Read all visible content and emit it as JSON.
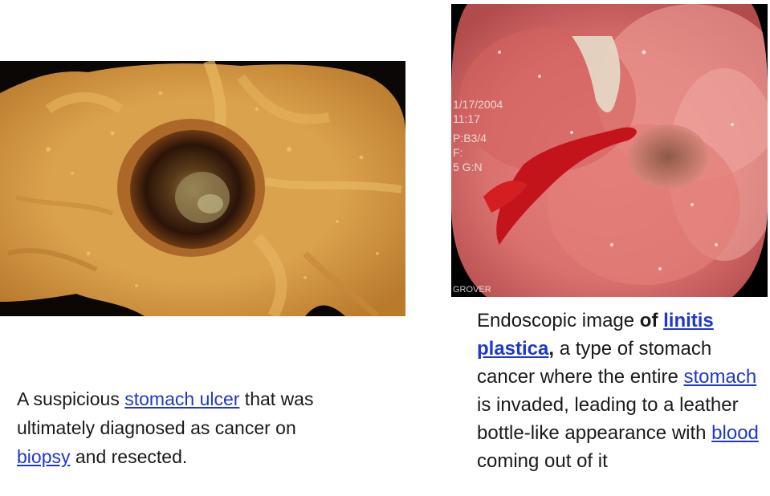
{
  "left_caption": {
    "part1": "A suspicious ",
    "link1": "stomach ulcer",
    "part2": " that was ultimately diagnosed as cancer on ",
    "link2": "biopsy",
    "part3": " and resected."
  },
  "right_caption": {
    "part1": "Endoscopic image ",
    "bold1": "of ",
    "link1": "linitis plastica",
    "bold2": ",",
    "part2": " a type of stomach cancer where the entire ",
    "link2": "stomach",
    "part3": " is invaded, leading to a leather bottle-like appearance with ",
    "link3": "blood",
    "part4": " coming out of it"
  },
  "endoscope_overlay": {
    "line1": "1/17/2004",
    "line2": "11:17",
    "line3": "P:B3/4",
    "line4": "F:",
    "line5": "5 G:N",
    "footer": "GROVER"
  },
  "colors": {
    "link": "#1f38c9",
    "text": "#1a1a1a",
    "ulcer_tissue": "#d9a04a",
    "endoscopy_tissue": "#d9716e",
    "blood": "#c3141c"
  }
}
